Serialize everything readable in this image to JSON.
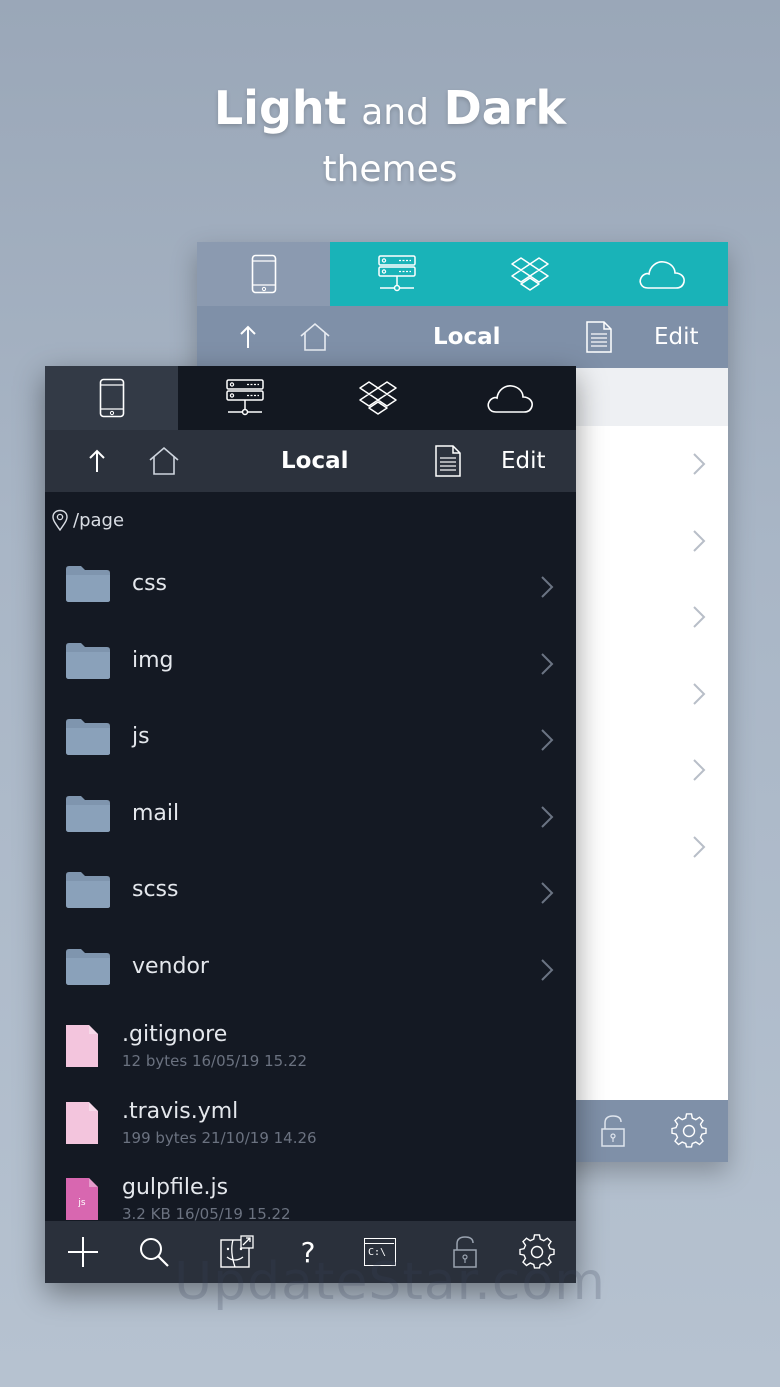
{
  "headline": {
    "light_word": "Light",
    "and_word": "and",
    "dark_word": "Dark",
    "subtitle": "themes"
  },
  "light_panel": {
    "tabs": [
      {
        "icon": "phone-icon"
      },
      {
        "icon": "server-icon"
      },
      {
        "icon": "dropbox-icon"
      },
      {
        "icon": "cloud-icon"
      }
    ],
    "toolbar": {
      "title": "Local",
      "edit_label": "Edit"
    },
    "row_count": 6
  },
  "dark_panel": {
    "toolbar": {
      "title": "Local",
      "edit_label": "Edit"
    },
    "path": "/page",
    "folders": [
      "css",
      "img",
      "js",
      "mail",
      "scss",
      "vendor"
    ],
    "files": [
      {
        "name": ".gitignore",
        "meta": "12 bytes 16/05/19 15.22",
        "badge": ""
      },
      {
        "name": ".travis.yml",
        "meta": "199 bytes 21/10/19 14.26",
        "badge": ""
      },
      {
        "name": "gulpfile.js",
        "meta": "3.2 KB 16/05/19 15.22",
        "badge": "js"
      }
    ],
    "bottom_icons": [
      "plus-icon",
      "search-icon",
      "finder-icon",
      "help-icon",
      "terminal-icon",
      "lock-icon",
      "gear-icon"
    ],
    "help_glyph": "?",
    "terminal_label": "C:\\"
  },
  "colors": {
    "teal_tab": "#19b3b8",
    "light_toolbar": "#7f90a8",
    "dark_bg": "#141923",
    "folder": "#7f95ae",
    "file_pink": "#f3c5dd",
    "js_file": "#d867b0"
  },
  "watermark": "UpdateStar.com"
}
